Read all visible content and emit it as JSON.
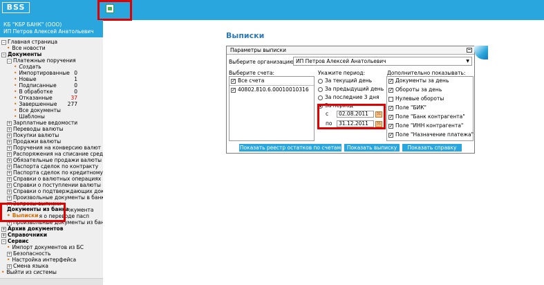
{
  "app": {
    "logo_text": "BSS"
  },
  "client": {
    "bank": "КБ \"КБР БАНК\" (ООО)",
    "user": "ИП Петров Алексей Анатольевич"
  },
  "sidebar": {
    "items": [
      {
        "label": "Главная страница",
        "toggle": "–"
      },
      {
        "label": "Все новости"
      },
      {
        "label": "Документы",
        "toggle": "–"
      },
      {
        "label": "Платежные поручения",
        "toggle": "–"
      },
      {
        "label": "Создать"
      },
      {
        "label": "Импортированные",
        "count": "0"
      },
      {
        "label": "Новые",
        "count": "1"
      },
      {
        "label": "Подписанные",
        "count": "0"
      },
      {
        "label": "В обработке",
        "count": "0"
      },
      {
        "label": "Отказанные",
        "count": "37"
      },
      {
        "label": "Завершенные",
        "count": "277"
      },
      {
        "label": "Все документы"
      },
      {
        "label": "Шаблоны"
      },
      {
        "label": "Зарплатные ведомости",
        "toggle": "+"
      },
      {
        "label": "Переводы валюты",
        "toggle": "+"
      },
      {
        "label": "Покупки валюты",
        "toggle": "+"
      },
      {
        "label": "Продажи валюты",
        "toggle": "+"
      },
      {
        "label": "Поручения на конверсию валют",
        "toggle": "+"
      },
      {
        "label": "Распоряжения на списание средств с",
        "toggle": "+"
      },
      {
        "label": "Обязательные продажи валюты",
        "toggle": "+"
      },
      {
        "label": "Паспорта сделок по контракту",
        "toggle": "+"
      },
      {
        "label": "Паспорта сделок по кредитному догов",
        "toggle": "+"
      },
      {
        "label": "Справки о валютных операциях",
        "toggle": "+"
      },
      {
        "label": "Справки о поступлении валюты РФ",
        "toggle": "+"
      },
      {
        "label": "Справки о подтверждающих документ",
        "toggle": "+"
      },
      {
        "label": "Произвольные документы в банк",
        "toggle": "+"
      },
      {
        "label": "Запросы выписки",
        "toggle": "+"
      },
      {
        "label": "Запросы на отзыв документа",
        "toggle": "+"
      },
      {
        "label": "Заявления о переводе пасп",
        "toggle": "+"
      },
      {
        "label": "Документы из банка"
      },
      {
        "label": "Выписки"
      },
      {
        "label": "Произвольные документы из банка",
        "toggle": "+"
      },
      {
        "label": "Архив документов",
        "toggle": "+"
      },
      {
        "label": "Справочники",
        "toggle": "+"
      },
      {
        "label": "Сервис",
        "toggle": "–"
      },
      {
        "label": "Импорт документов из БС"
      },
      {
        "label": "Безопасность",
        "toggle": "+"
      },
      {
        "label": "Настройка интерфейса"
      },
      {
        "label": "Смена языка",
        "toggle": "+"
      },
      {
        "label": "Выйти из системы"
      }
    ]
  },
  "main": {
    "title": "Выписки",
    "panel": {
      "title": "Параметры выписки",
      "org_label": "Выберите организацию:",
      "org_value": "ИП Петров Алексей Анатольевич",
      "accounts_label": "Выберите счета:",
      "all_accounts": "Все счета",
      "account": "40802.810.6.00010010316",
      "period_label": "Укажите период:",
      "period_options": [
        "За текущий день",
        "За предыдущий день",
        "За последние 3 дня",
        "За период"
      ],
      "from_label": "с",
      "from_value": "02.08.2011",
      "to_label": "по",
      "to_value": "31.12.2011",
      "extra_label": "Дополнительно показывать:",
      "extras": [
        {
          "label": "Документы за день",
          "checked": true
        },
        {
          "label": "Обороты за день",
          "checked": true
        },
        {
          "label": "Нулевые обороты",
          "checked": false
        },
        {
          "label": "Поле \"БИК\"",
          "checked": true
        },
        {
          "label": "Поле \"Банк контрагента\"",
          "checked": true
        },
        {
          "label": "Поле \"ИНН контрагента\"",
          "checked": true
        },
        {
          "label": "Поле \"Назначение платежа\"",
          "checked": true
        }
      ],
      "buttons": [
        "Показать реестр остатков по счетам",
        "Показать выписку",
        "Показать справку"
      ]
    }
  },
  "colors": {
    "accent": "#29a6dd",
    "highlight": "#e00000",
    "counter_alert": "#e00000",
    "active_item": "#d46b00"
  }
}
